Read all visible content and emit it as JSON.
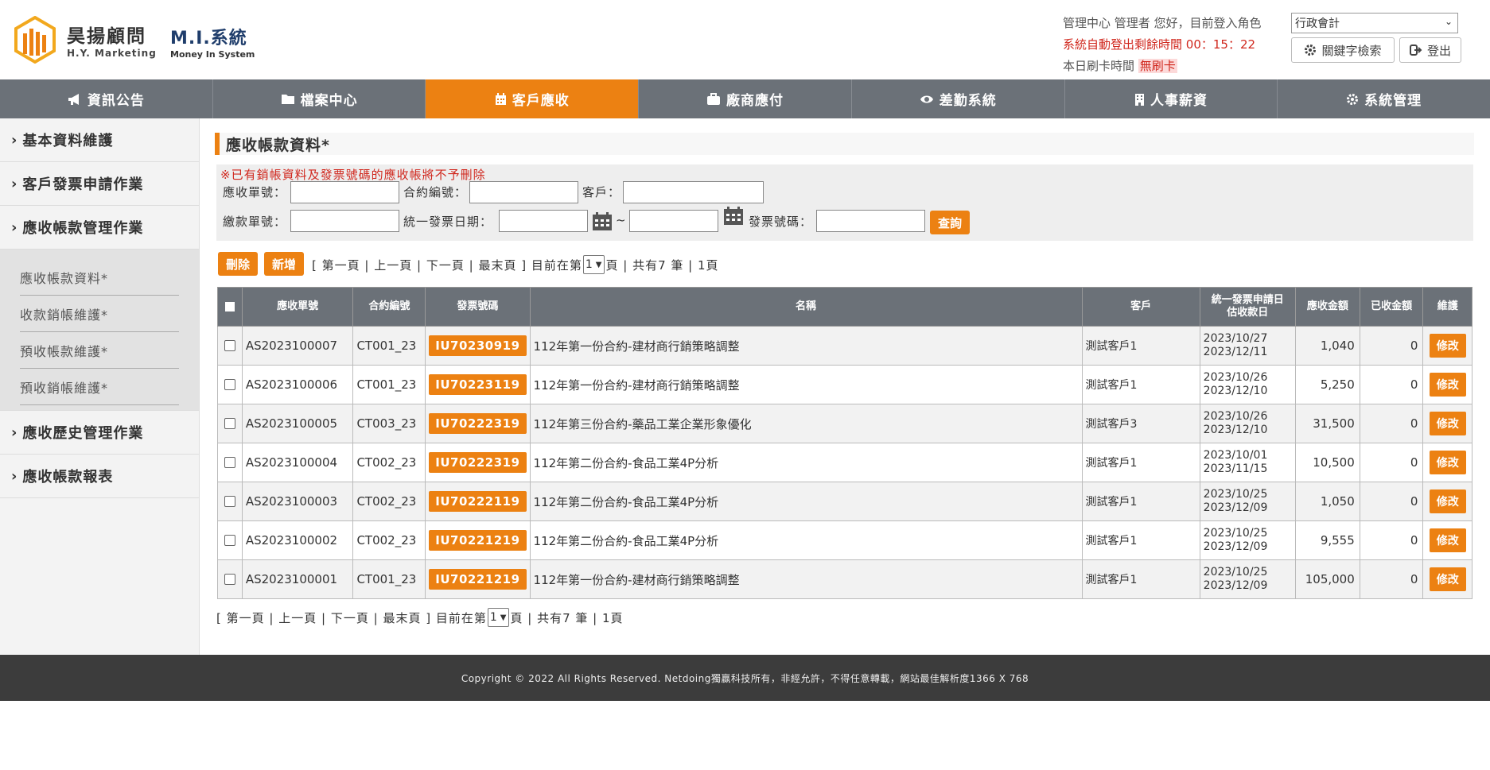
{
  "header": {
    "brand_cn": "昊揚顧問",
    "brand_en": "H.Y. Marketing",
    "system_name": "M.I.系統",
    "system_sub": "Money In System",
    "greeting": "管理中心 管理者 您好，目前登入角色",
    "role_selected": "行政會計",
    "logout_timer_label": "系統自動登出剩餘時間 00：15：22",
    "punch_label": "本日刷卡時間",
    "punch_value": "無刷卡",
    "keyword_search_label": "關鍵字檢索",
    "logout_label": "登出"
  },
  "nav": [
    {
      "label": "資訊公告",
      "icon": "bullhorn-icon"
    },
    {
      "label": "檔案中心",
      "icon": "folder-icon"
    },
    {
      "label": "客戶應收",
      "icon": "calendar-icon",
      "active": true
    },
    {
      "label": "廠商應付",
      "icon": "briefcase-icon"
    },
    {
      "label": "差勤系統",
      "icon": "eye-icon"
    },
    {
      "label": "人事薪資",
      "icon": "building-icon"
    },
    {
      "label": "系統管理",
      "icon": "gear-icon"
    }
  ],
  "sidebar": {
    "items": [
      "基本資料維護",
      "客戶發票申請作業",
      "應收帳款管理作業"
    ],
    "sub_items": [
      "應收帳款資料*",
      "收款銷帳維護*",
      "預收帳款維護*",
      "預收銷帳維護*"
    ],
    "items_after": [
      "應收歷史管理作業",
      "應收帳款報表"
    ]
  },
  "page_title": "應收帳款資料*",
  "search": {
    "warning": "※已有銷帳資料及發票號碼的應收帳將不予刪除",
    "ar_no_label": "應收單號：",
    "contract_no_label": "合約編號：",
    "customer_label": "客戶：",
    "payment_no_label": "繳款單號：",
    "invoice_date_label": "統一發票日期：",
    "tilde": "~",
    "invoice_no_label": "發票號碼：",
    "query_label": "查詢"
  },
  "actions": {
    "delete_label": "刪除",
    "add_label": "新增"
  },
  "pager": {
    "first": "[ 第一頁",
    "prev": "| 上一頁",
    "next": "| 下一頁",
    "last": "| 最末頁 ]",
    "current_prefix": " 目前在第",
    "current_page": "1",
    "current_suffix": "頁",
    "total": " | 共有7 筆 | 1頁"
  },
  "table": {
    "headers": {
      "ar_no": "應收單號",
      "contract": "合約編號",
      "invoice": "發票號碼",
      "name": "名稱",
      "customer": "客戶",
      "dates_1": "統一發票申請日",
      "dates_2": "估收款日",
      "amount": "應收金額",
      "received": "已收金額",
      "maintain": "維護"
    },
    "edit_label": "修改",
    "rows": [
      {
        "ar_no": "AS2023100007",
        "contract": "CT001_23",
        "invoice": "IU70230919",
        "name": "112年第一份合約-建材商行銷策略調整",
        "customer": "測試客戶1",
        "date1": "2023/10/27",
        "date2": "2023/12/11",
        "amount": "1,040",
        "received": "0"
      },
      {
        "ar_no": "AS2023100006",
        "contract": "CT001_23",
        "invoice": "IU70223119",
        "name": "112年第一份合約-建材商行銷策略調整",
        "customer": "測試客戶1",
        "date1": "2023/10/26",
        "date2": "2023/12/10",
        "amount": "5,250",
        "received": "0"
      },
      {
        "ar_no": "AS2023100005",
        "contract": "CT003_23",
        "invoice": "IU70222319",
        "name": "112年第三份合約-藥品工業企業形象優化",
        "customer": "測試客戶3",
        "date1": "2023/10/26",
        "date2": "2023/12/10",
        "amount": "31,500",
        "received": "0"
      },
      {
        "ar_no": "AS2023100004",
        "contract": "CT002_23",
        "invoice": "IU70222319",
        "name": "112年第二份合約-食品工業4P分析",
        "customer": "測試客戶1",
        "date1": "2023/10/01",
        "date2": "2023/11/15",
        "amount": "10,500",
        "received": "0"
      },
      {
        "ar_no": "AS2023100003",
        "contract": "CT002_23",
        "invoice": "IU70222119",
        "name": "112年第二份合約-食品工業4P分析",
        "customer": "測試客戶1",
        "date1": "2023/10/25",
        "date2": "2023/12/09",
        "amount": "1,050",
        "received": "0"
      },
      {
        "ar_no": "AS2023100002",
        "contract": "CT002_23",
        "invoice": "IU70221219",
        "name": "112年第二份合約-食品工業4P分析",
        "customer": "測試客戶1",
        "date1": "2023/10/25",
        "date2": "2023/12/09",
        "amount": "9,555",
        "received": "0"
      },
      {
        "ar_no": "AS2023100001",
        "contract": "CT001_23",
        "invoice": "IU70221219",
        "name": "112年第一份合約-建材商行銷策略調整",
        "customer": "測試客戶1",
        "date1": "2023/10/25",
        "date2": "2023/12/09",
        "amount": "105,000",
        "received": "0"
      }
    ]
  },
  "footer": "Copyright © 2022 All Rights Reserved. Netdoing獨贏科技所有，非經允許，不得任意轉載，網站最佳解析度1366 X 768",
  "colors": {
    "accent": "#ec8112",
    "nav_bg": "#6b7178",
    "warn": "#d0271d",
    "footer_bg": "#3c3c3c"
  }
}
